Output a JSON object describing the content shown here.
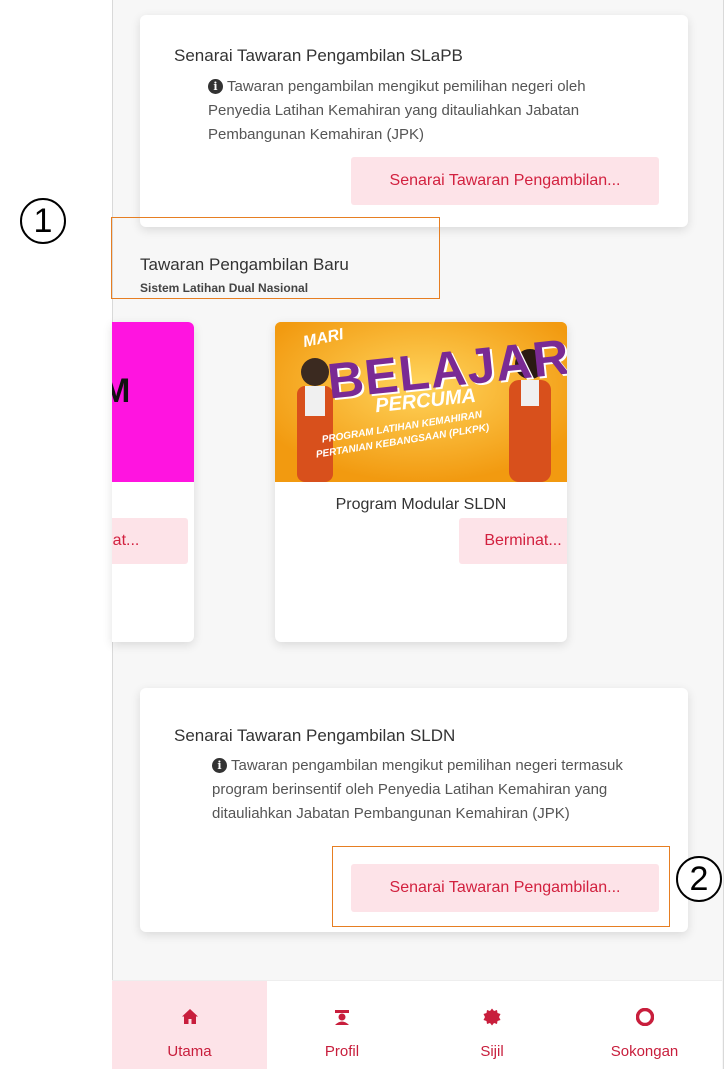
{
  "top_card": {
    "title": "Senarai Tawaran Pengambilan SLaPB",
    "description": "Tawaran pengambilan mengikut pemilihan negeri oleh Penyedia Latihan Kemahiran yang ditauliahkan Jabatan Pembangunan Kemahiran (JPK)",
    "button_label": "Senarai Tawaran Pengambilan..."
  },
  "new_intake": {
    "title": "Tawaran Pengambilan Baru",
    "subtitle": "Sistem Latihan Dual Nasional"
  },
  "carousel": {
    "prev_card": {
      "partial_letter": "M",
      "button_label": "Berminat..."
    },
    "card": {
      "banner_mari": "MARI",
      "banner_belajar": "BELAJAR",
      "banner_percuma": "PERCUMA",
      "banner_program_1": "PROGRAM LATIHAN KEMAHIRAN",
      "banner_program_2": "PERTANIAN KEBANGSAAN (PLKPK)",
      "name": "Program Modular SLDN",
      "button_label": "Berminat..."
    }
  },
  "sldn_card": {
    "title": "Senarai Tawaran Pengambilan SLDN",
    "description": "Tawaran pengambilan mengikut pemilihan negeri termasuk program berinsentif oleh Penyedia Latihan Kemahiran yang ditauliahkan Jabatan Pembangunan Kemahiran (JPK)",
    "button_label": "Senarai Tawaran Pengambilan..."
  },
  "callouts": {
    "one": "1",
    "two": "2"
  },
  "bottom_nav": {
    "items": [
      {
        "label": "Utama",
        "icon": "home-icon"
      },
      {
        "label": "Profil",
        "icon": "graduate-profile-icon"
      },
      {
        "label": "Sijil",
        "icon": "certificate-badge-icon"
      },
      {
        "label": "Sokongan",
        "icon": "lifebuoy-support-icon"
      }
    ],
    "active_index": 0
  },
  "colors": {
    "accent": "#c81e3c",
    "button_bg": "#fde3e8",
    "annotation": "#e67e22",
    "banner_bg": "#f2a51a",
    "prev_card_bg": "#ff14e0"
  }
}
